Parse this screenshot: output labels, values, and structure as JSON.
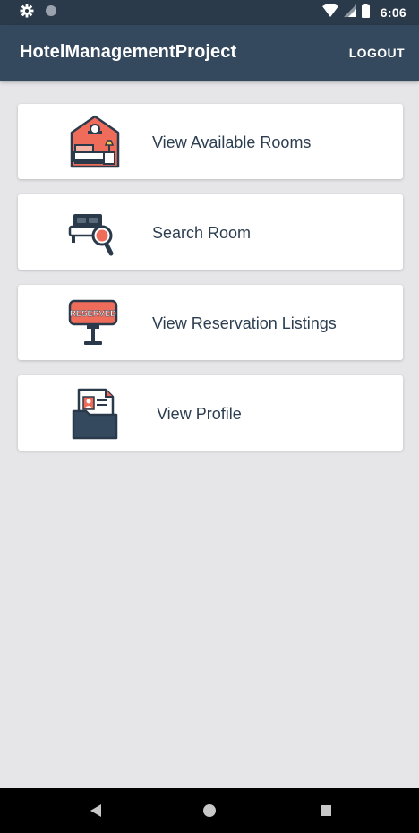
{
  "status_bar": {
    "time": "6:06",
    "icons": [
      "settings-icon",
      "circle-icon",
      "wifi-icon",
      "signal-icon",
      "battery-icon"
    ]
  },
  "app_bar": {
    "title": "HotelManagementProject",
    "logout_label": "LOGOUT"
  },
  "menu": {
    "items": [
      {
        "label": "View Available Rooms",
        "icon": "hotel-room-icon"
      },
      {
        "label": "Search Room",
        "icon": "search-room-icon"
      },
      {
        "label": "View Reservation Listings",
        "icon": "reserved-sign-icon",
        "icon_text": "RESERVED"
      },
      {
        "label": "View Profile",
        "icon": "profile-folder-icon"
      }
    ]
  },
  "nav_bar": {
    "icons": [
      "back-icon",
      "home-icon",
      "recents-icon"
    ]
  },
  "colors": {
    "status_bar": "#2b3a4b",
    "app_bar": "#34495e",
    "background": "#e6e5e8",
    "card": "#ffffff",
    "text": "#2c3e50",
    "accent_red": "#ef6c5a",
    "dark_navy": "#2b3a4b"
  }
}
